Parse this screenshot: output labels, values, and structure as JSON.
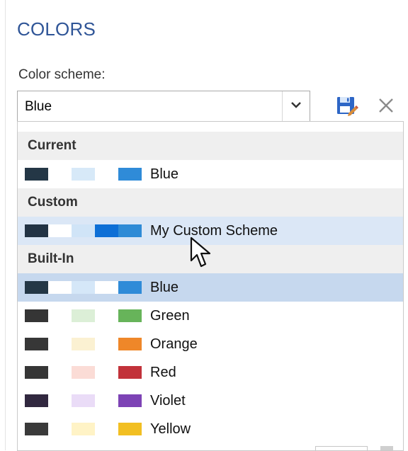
{
  "panel": {
    "title": "COLORS",
    "color_scheme_label": "Color scheme:",
    "selected_value": "Blue"
  },
  "icons": {
    "dropdown_arrow": "chevron-down-icon",
    "save": "save-scheme-icon",
    "close": "close-icon",
    "cursor": "mouse-pointer-icon"
  },
  "colors": {
    "title_blue": "#2f5597",
    "hover_row": "#dbe7f6",
    "selected_row": "#c6d8ee",
    "header_bg": "#efefef"
  },
  "dropdown": {
    "groups": [
      {
        "header": "Current",
        "items": [
          {
            "label": "Blue",
            "state": "normal",
            "swatches": [
              "#243746",
              "#ffffff",
              "#d7e9f8",
              "#ffffff",
              "#2f8bd8"
            ]
          }
        ]
      },
      {
        "header": "Custom",
        "items": [
          {
            "label": "My Custom Scheme",
            "state": "hover",
            "swatches": [
              "#223344",
              "#ffffff",
              "#d0e4f7",
              "#0d6fd6",
              "#2e8bd6"
            ]
          }
        ]
      },
      {
        "header": "Built-In",
        "items": [
          {
            "label": "Blue",
            "state": "selected",
            "swatches": [
              "#243746",
              "#ffffff",
              "#d5e7f8",
              "#ffffff",
              "#2f8bd8"
            ]
          },
          {
            "label": "Green",
            "state": "normal",
            "swatches": [
              "#353535",
              "#ffffff",
              "#dcefd7",
              "#ffffff",
              "#67b45a"
            ]
          },
          {
            "label": "Orange",
            "state": "normal",
            "swatches": [
              "#373737",
              "#ffffff",
              "#fbf1d2",
              "#ffffff",
              "#ef8729"
            ]
          },
          {
            "label": "Red",
            "state": "normal",
            "swatches": [
              "#363636",
              "#ffffff",
              "#fbdcd6",
              "#ffffff",
              "#c2323a"
            ]
          },
          {
            "label": "Violet",
            "state": "normal",
            "swatches": [
              "#31283f",
              "#ffffff",
              "#eadcf7",
              "#ffffff",
              "#7d43b5"
            ]
          },
          {
            "label": "Yellow",
            "state": "normal",
            "swatches": [
              "#3a3a3a",
              "#ffffff",
              "#fff3c6",
              "#ffffff",
              "#f2bf22"
            ]
          }
        ]
      }
    ]
  }
}
